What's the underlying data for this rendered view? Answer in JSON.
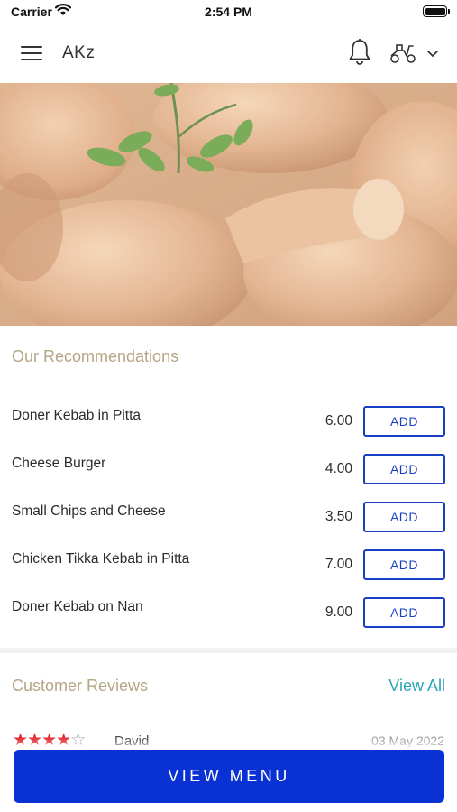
{
  "status_bar": {
    "carrier": "Carrier",
    "time": "2:54 PM"
  },
  "header": {
    "title": "AKz",
    "icons": [
      "menu-icon",
      "bell-icon",
      "scooter-icon",
      "chevron-down-icon"
    ]
  },
  "hero": {
    "image": "roast-chicken-drumsticks-with-parsley"
  },
  "recommendations": {
    "title": "Our Recommendations",
    "add_label": "ADD",
    "items": [
      {
        "name": "Doner Kebab in Pitta",
        "price": "6.00"
      },
      {
        "name": "Cheese Burger",
        "price": "4.00"
      },
      {
        "name": "Small Chips and Cheese",
        "price": "3.50"
      },
      {
        "name": "Chicken Tikka Kebab in Pitta",
        "price": "7.00"
      },
      {
        "name": "Doner Kebab on Nan",
        "price": "9.00"
      }
    ]
  },
  "reviews": {
    "title": "Customer Reviews",
    "view_all": "View All",
    "items": [
      {
        "name": "David",
        "date": "03 May 2022",
        "rating": 4,
        "max_rating": 5
      }
    ]
  },
  "cta": {
    "label": "VIEW MENU"
  },
  "colors": {
    "accent_blue": "#0a31d4",
    "section_title": "#b5a585",
    "link_teal": "#2aa4b8",
    "star_red": "#e0262a"
  }
}
